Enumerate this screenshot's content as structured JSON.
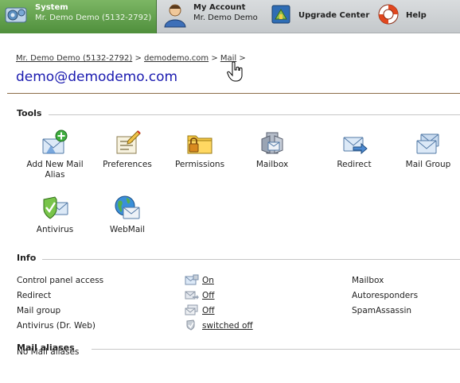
{
  "nav": {
    "tabs": [
      {
        "title": "System",
        "subtitle": "Mr. Demo Demo (5132-2792)"
      },
      {
        "title": "My Account",
        "subtitle": "Mr. Demo Demo"
      },
      {
        "title": "Upgrade Center",
        "subtitle": ""
      },
      {
        "title": "Help",
        "subtitle": ""
      }
    ]
  },
  "breadcrumb": {
    "items": [
      "Mr. Demo Demo (5132-2792)",
      "demodemo.com",
      "Mail"
    ],
    "separator": ">"
  },
  "page_title": "demo@demodemo.com",
  "tools": {
    "heading": "Tools",
    "items": [
      {
        "label": "Add New Mail Alias",
        "icon": "add-mail-alias-icon"
      },
      {
        "label": "Preferences",
        "icon": "preferences-icon"
      },
      {
        "label": "Permissions",
        "icon": "permissions-icon"
      },
      {
        "label": "Mailbox",
        "icon": "mailbox-icon"
      },
      {
        "label": "Redirect",
        "icon": "redirect-icon"
      },
      {
        "label": "Mail Group",
        "icon": "mail-group-icon"
      },
      {
        "label": "Antivirus",
        "icon": "antivirus-icon"
      },
      {
        "label": "WebMail",
        "icon": "webmail-icon"
      }
    ]
  },
  "info": {
    "heading": "Info",
    "rows": [
      {
        "label": "Control panel access",
        "value": "On",
        "icon": "control-panel-access-icon"
      },
      {
        "label": "Redirect",
        "value": "Off",
        "icon": "redirect-status-icon"
      },
      {
        "label": "Mail group",
        "value": "Off",
        "icon": "mail-group-status-icon"
      },
      {
        "label": "Antivirus (Dr. Web)",
        "value": "switched off",
        "icon": "antivirus-status-icon"
      }
    ],
    "right_items": [
      "Mailbox",
      "Autoresponders",
      "SpamAssassin"
    ]
  },
  "mail_aliases": {
    "heading": "Mail aliases",
    "empty_text": "No Mail aliases"
  },
  "colors": {
    "active_tab": "#5f9e48",
    "title_blue": "#1b1bb0",
    "header_rule": "#8c6d48"
  }
}
